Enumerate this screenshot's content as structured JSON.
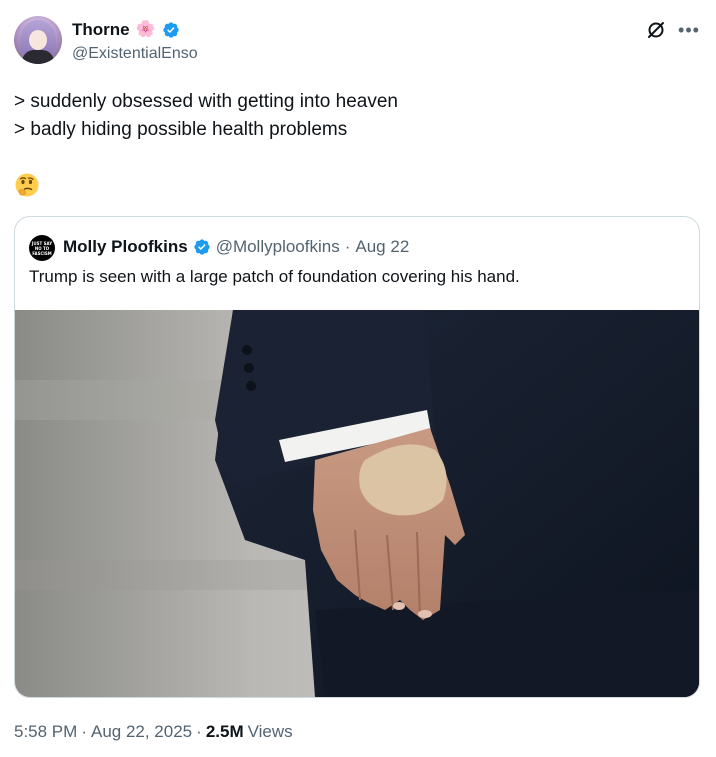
{
  "author": {
    "display_name": "Thorne",
    "name_emoji": "🌸",
    "handle": "@ExistentialEnso",
    "verified": true
  },
  "icons": {
    "verified": "verified-badge-icon",
    "grok": "grok-icon",
    "more": "more-options-icon"
  },
  "tweet": {
    "lines": [
      "> suddenly obsessed with getting into heaven",
      "> badly hiding possible health problems"
    ],
    "emoji": "🤔"
  },
  "quote": {
    "display_name": "Molly Ploofkins",
    "handle": "@Mollyploofkins",
    "separator": "·",
    "date": "Aug 22",
    "text": "Trump is seen with a large patch of foundation covering his hand.",
    "avatar_text": "JUST SAY NO TO FASCISM"
  },
  "meta": {
    "time": "5:58 PM",
    "sep1": "·",
    "date": "Aug 22, 2025",
    "sep2": "·",
    "views_count": "2.5M",
    "views_label": "Views"
  },
  "colors": {
    "verified_blue": "#1d9bf0",
    "secondary_text": "#536471",
    "primary_text": "#0f1419",
    "border": "#cfd9de",
    "suit": "#1b2336"
  }
}
